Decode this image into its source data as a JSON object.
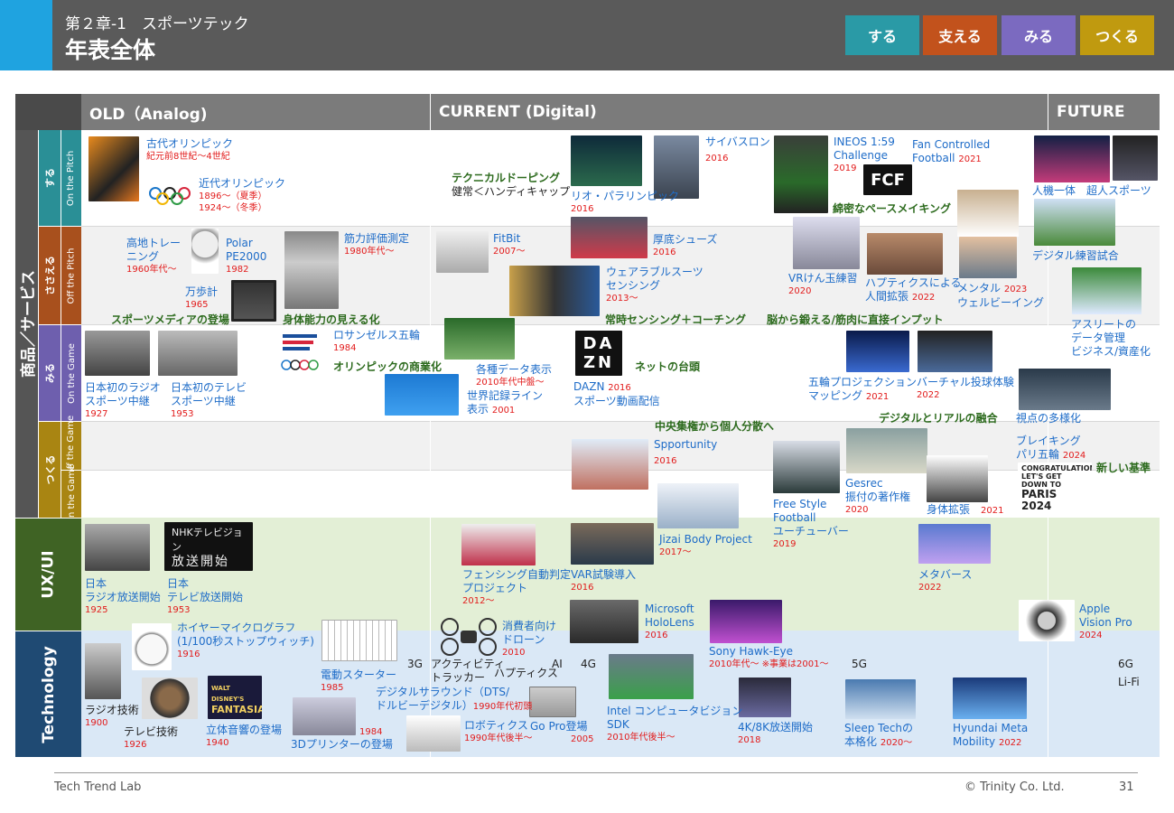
{
  "header": {
    "chapter": "第２章-1　スポーツテック",
    "title": "年表全体",
    "buttons": [
      {
        "label": "する",
        "color": "#2a9aa6"
      },
      {
        "label": "支える",
        "color": "#c2521c"
      },
      {
        "label": "みる",
        "color": "#7b6ac0"
      },
      {
        "label": "つくる",
        "color": "#c09a0f"
      }
    ]
  },
  "columns": {
    "old": "OLD（Analog)",
    "current": "CURRENT (Digital)",
    "future": "FUTURE"
  },
  "rows": {
    "main": "商品／サービス",
    "suru": "する",
    "sasaeru": "ささえる",
    "miru": "みる",
    "tsukuru": "つくる",
    "on_pitch": "On the Pitch",
    "off_pitch": "Off the Pitch",
    "on_game": "On the Game",
    "off_game": "Off the Game",
    "on_game2": "On the Game",
    "uxui": "UX/UI",
    "technology": "Technology"
  },
  "items": {
    "olympic_ancient": {
      "name": "古代オリンピック",
      "year": "紀元前8世紀〜4世紀"
    },
    "olympic_modern": {
      "name": "近代オリンピック",
      "y1": "1896〜（夏季）",
      "y2": "1924〜（冬季）"
    },
    "altitude": {
      "name1": "高地トレー",
      "name2": "ニング",
      "year": "1960年代〜"
    },
    "polar": {
      "name1": "Polar",
      "name2": "PE2000",
      "year": "1982"
    },
    "muscle": {
      "name": "筋力評価測定",
      "year": "1980年代〜"
    },
    "pedometer": {
      "name": "万歩計",
      "year": "1965"
    },
    "radio_broadcast": {
      "name1": "日本初のラジオ",
      "name2": "スポーツ中継",
      "year": "1927"
    },
    "tv_broadcast": {
      "name1": "日本初のテレビ",
      "name2": "スポーツ中継",
      "year": "1953"
    },
    "la_olympics": {
      "name": "ロサンゼルス五輪",
      "year": "1984"
    },
    "doping": {
      "name1": "テクニカルドーピング",
      "name2": "健常＜ハンディキャップ"
    },
    "rio": {
      "name": "リオ・パラリンピック",
      "year": "2016"
    },
    "cybathlon": {
      "name": "サイバスロン",
      "year": "2016"
    },
    "ineos": {
      "name1": "INEOS 1:59",
      "name2": "Challenge",
      "year": "2019"
    },
    "fan_controlled": {
      "name1": "Fan Controlled",
      "name2": "Football",
      "year": "2021"
    },
    "fcf_logo": "FCF",
    "human_machine": "人機一体　超人スポーツ",
    "fitbit": {
      "name": "FitBit",
      "year": "2007〜"
    },
    "shoes": {
      "name": "厚底シューズ",
      "year": "2016"
    },
    "wearable": {
      "name1": "ウェアラブルスーツ",
      "name2": "センシング",
      "year": "2013〜"
    },
    "vr_kendama": {
      "name": "VRけん玉練習",
      "year": "2020"
    },
    "haptics_ext": {
      "name1": "ハプティクスによる",
      "name2": "人間拡張",
      "year": "2022"
    },
    "mental": {
      "name1": "メンタル",
      "name2": "ウェルビーイング",
      "year": "2023"
    },
    "digital_practice": "デジタル練習試合",
    "athlete_data": {
      "name1": "アスリートの",
      "name2": "データ管理",
      "name3": "ビジネス/資産化"
    },
    "data_display": {
      "name": "各種データ表示",
      "year": "2010年代中盤〜"
    },
    "world_record": {
      "name1": "世界記録ライン",
      "name2": "表示",
      "year": "2001"
    },
    "dazn": {
      "name1": "DAZN",
      "name2": "スポーツ動画配信",
      "year": "2016",
      "logo1": "DA",
      "logo2": "ZN"
    },
    "projection": {
      "name1": "五輪プロジェクション",
      "name2": "マッピング",
      "year": "2021"
    },
    "virtual_pitch": {
      "name": "バーチャル投球体験",
      "year": "2022"
    },
    "multi_view": "視点の多様化",
    "spportunity": {
      "name": "Spportunity",
      "year": "2016"
    },
    "freestyle": {
      "name1": "Free Style",
      "name2": "Football",
      "name3": "ユーチューバー",
      "year": "2019"
    },
    "gesrec": {
      "name1": "Gesrec",
      "name2": "振付の著作権",
      "year": "2020"
    },
    "body_ext": {
      "name": "身体拡張",
      "year": "2021"
    },
    "breaking": {
      "name1": "ブレイキング",
      "name2": "パリ五輪",
      "year": "2024"
    },
    "jizai": {
      "name": "Jizai Body  Project",
      "year": "2017〜"
    },
    "paris_poster": {
      "l1": "CONGRATULATIONS",
      "l2": "LET'S GET",
      "l3": "DOWN TO",
      "l4": "PARIS",
      "l5": "2024"
    },
    "radio_start": {
      "name1": "日本",
      "name2": "ラジオ放送開始",
      "year": "1925"
    },
    "tv_start": {
      "name1": "日本",
      "name2": "テレビ放送開始",
      "year": "1953"
    },
    "nhk_card": {
      "l1": "NHKテレビジョン",
      "l2": "放送開始"
    },
    "fencing": {
      "name1": "フェンシング自動判定",
      "name2": "プロジェクト",
      "year": "2012〜"
    },
    "var": {
      "name": "VAR試験導入",
      "year": "2016"
    },
    "hololens": {
      "name1": "Microsoft",
      "name2": "HoloLens",
      "year": "2016"
    },
    "hawkeye": {
      "name": "Sony Hawk-Eye",
      "year": "2010年代〜 ※事業は2001〜"
    },
    "metaverse": {
      "name": "メタバース",
      "year": "2022"
    },
    "vision_pro": {
      "name1": "Apple",
      "name2": "Vision  Pro",
      "year": "2024"
    },
    "heuer": {
      "name1": "ホイヤーマイクログラフ",
      "name2": "(1/100秒ストップウィッチ)",
      "year": "1916"
    },
    "electric_starter": {
      "name": "電動スターター",
      "year": "1985"
    },
    "radio_tech": {
      "name": "ラジオ技術",
      "year": "1900"
    },
    "tv_tech": {
      "name": "テレビ技術",
      "year": "1926"
    },
    "stereo": {
      "name": "立体音響の登場",
      "year": "1940"
    },
    "fantasia": {
      "l1": "WALT DISNEY'S",
      "l2": "FANTASIA"
    },
    "printer3d": {
      "name": "3Dプリンターの登場",
      "year": "1984"
    },
    "consumer_drone": {
      "name1": "消費者向け",
      "name2": "ドローン",
      "year": "2010"
    },
    "tracker": {
      "name1": "アクティビティ",
      "name2": "トラッカー"
    },
    "haptics": "ハプティクス",
    "dts": {
      "name1": "デジタルサラウンド（DTS/",
      "name2": "ドルビーデジタル）",
      "year": "1990年代初頭"
    },
    "robotics": {
      "name": "ロボティクス",
      "year": "1990年代後半〜"
    },
    "gopro": {
      "name": "Go Pro登場",
      "year": "2005"
    },
    "intel": {
      "name1": "Intel コンピュータビジョン",
      "name2": "SDK",
      "year": "2010年代後半〜"
    },
    "k8": {
      "name": "4K/8K放送開始",
      "year": "2018"
    },
    "sleep": {
      "name1": "Sleep Techの",
      "name2": "本格化",
      "year": "2020〜"
    },
    "hyundai": {
      "name1": "Hyundai Meta",
      "name2": "Mobility",
      "year": "2022"
    },
    "g3": "3G",
    "ai": "AI",
    "g4": "4G",
    "g5": "5G",
    "g6": "6G",
    "lifi": "Li-Fi"
  },
  "headlines": {
    "sports_media": "スポーツメディアの登場",
    "body_visual": "身体能力の見える化",
    "olympic_commercial": "オリンピックの商業化",
    "sensing_coaching": "常時センシング＋コーチング",
    "brain_muscle": "脳から鍛える/筋肉に直接インプット",
    "pace_making": "綿密なペースメイキング",
    "net_rise": "ネットの台頭",
    "decentralize": "中央集権から個人分散へ",
    "digital_real": "デジタルとリアルの融合",
    "new_standard": "新しい基準"
  },
  "footer": {
    "left": "Tech Trend Lab",
    "copyright": "© Trinity Co. Ltd.",
    "page": "31"
  }
}
